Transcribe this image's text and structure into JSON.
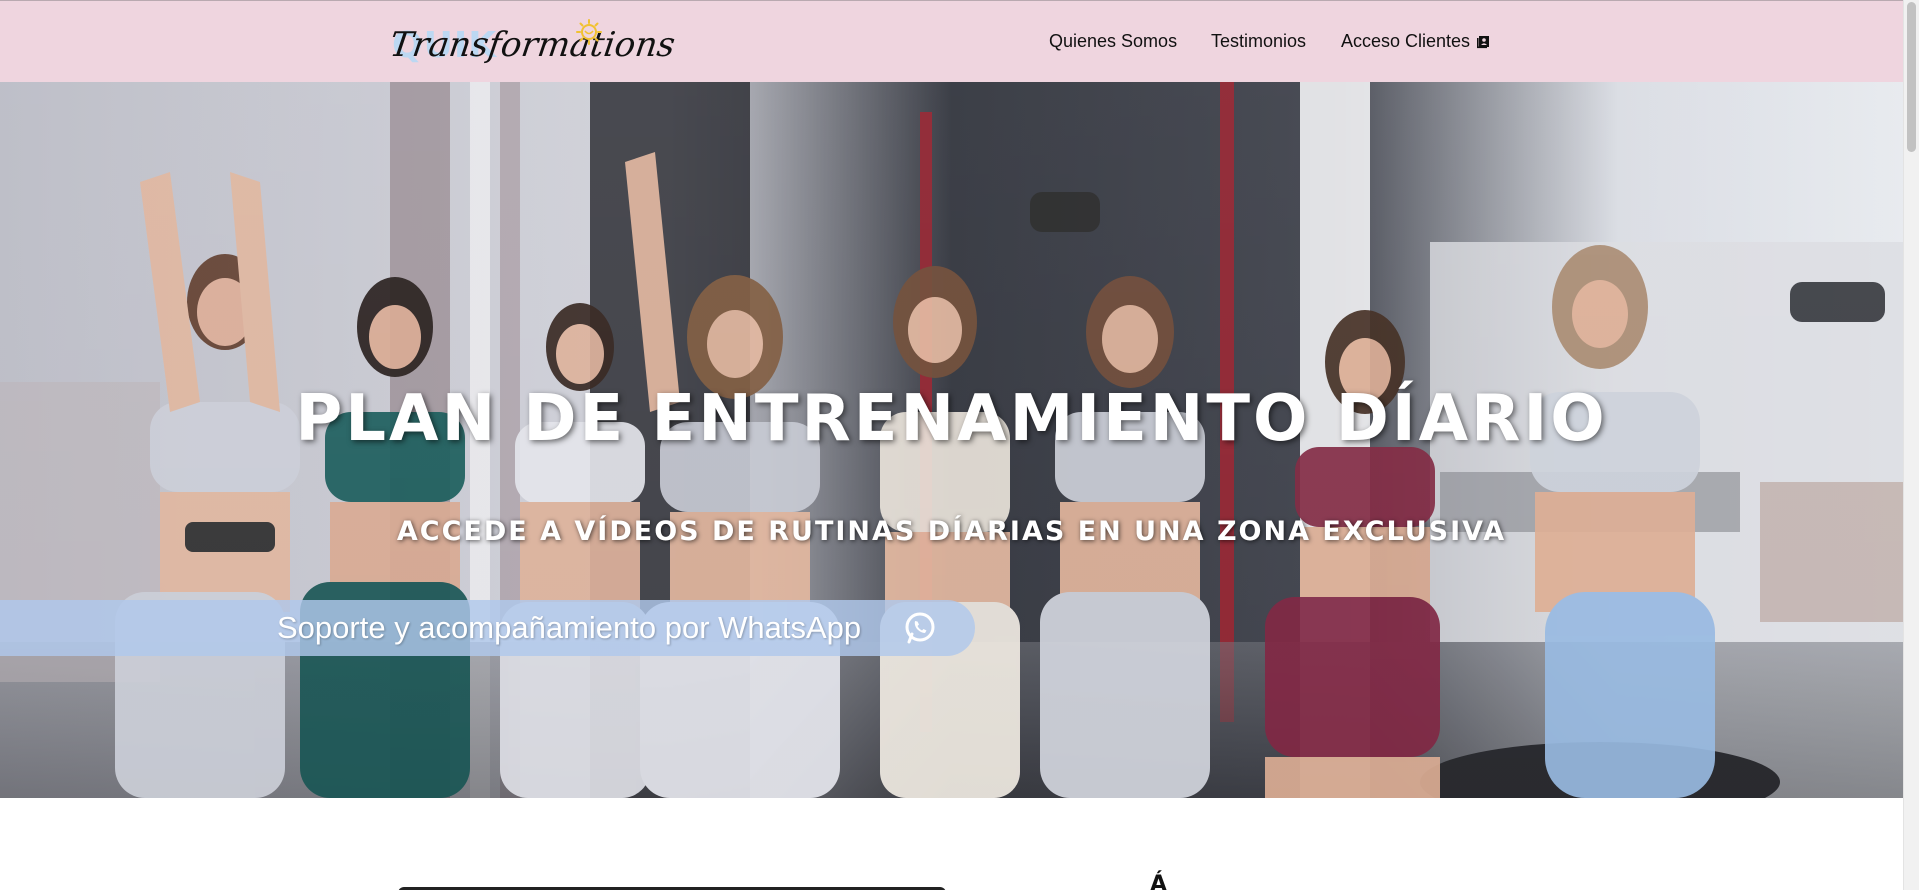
{
  "header": {
    "logo_text": "Transformations",
    "logo_bg_text": "QUIK",
    "nav": [
      {
        "label": "Quienes Somos"
      },
      {
        "label": "Testimonios"
      },
      {
        "label": "Acceso Clientes"
      }
    ]
  },
  "hero": {
    "title": "PLAN DE ENTRENAMIENTO DÍARIO",
    "subtitle": "ACCEDE A VÍDEOS DE RUTINAS DÍARIAS EN UNA ZONA EXCLUSIVA",
    "whatsapp_label": "Soporte y acompañamiento por WhatsApp"
  },
  "below_fold": {
    "glyph": "Á"
  },
  "icons": {
    "contact": "contact-book-icon",
    "whatsapp": "whatsapp-icon",
    "logo_sun": "sun-icon"
  },
  "colors": {
    "header_bg": "#efd5df",
    "whatsapp_bar": "#b0c8ec",
    "text_light": "#ffffff",
    "text_dark": "#111111"
  }
}
